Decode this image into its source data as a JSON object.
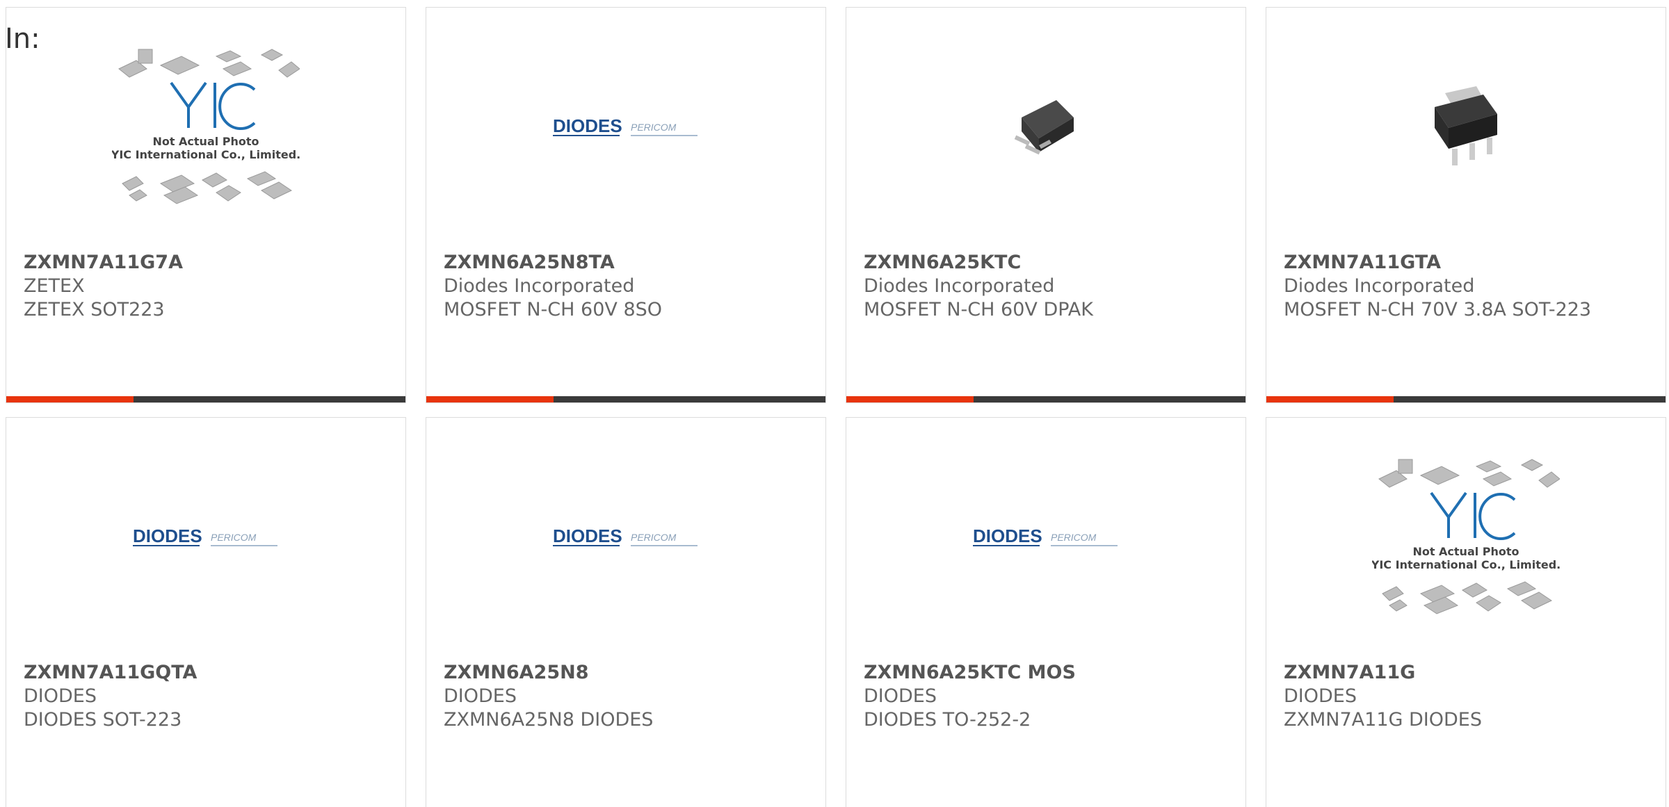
{
  "header": {
    "label": "In:"
  },
  "placeholder": {
    "logo": "YIC",
    "line1": "Not Actual Photo",
    "line2": "YIC International Co., Limited."
  },
  "diodes_logo": {
    "brand": "DIODES",
    "partner": "PERICOM"
  },
  "colors": {
    "accent": "#e8340d",
    "bar": "#3a3a3a",
    "border": "#dcdcdc",
    "text": "#666666",
    "diodes_blue": "#1f4f8e"
  },
  "products": [
    {
      "part": "ZXMN7A11G7A",
      "maker": "ZETEX",
      "desc": "ZETEX SOT223",
      "image": "placeholder-photo"
    },
    {
      "part": "ZXMN6A25N8TA",
      "maker": "Diodes Incorporated",
      "desc": "MOSFET N-CH 60V 8SO",
      "image": "diodes-logo"
    },
    {
      "part": "ZXMN6A25KTC",
      "maker": "Diodes Incorporated",
      "desc": "MOSFET N-CH 60V DPAK",
      "image": "dpak-package"
    },
    {
      "part": "ZXMN7A11GTA",
      "maker": "Diodes Incorporated",
      "desc": "MOSFET N-CH 70V 3.8A SOT-223",
      "image": "sot223-package"
    },
    {
      "part": "ZXMN7A11GQTA",
      "maker": "DIODES",
      "desc": "DIODES SOT-223",
      "image": "diodes-logo"
    },
    {
      "part": "ZXMN6A25N8",
      "maker": "DIODES",
      "desc": "ZXMN6A25N8 DIODES",
      "image": "diodes-logo"
    },
    {
      "part": "ZXMN6A25KTC MOS",
      "maker": "DIODES",
      "desc": "DIODES TO-252-2",
      "image": "diodes-logo"
    },
    {
      "part": "ZXMN7A11G",
      "maker": "DIODES",
      "desc": "ZXMN7A11G DIODES",
      "image": "placeholder-photo"
    }
  ]
}
